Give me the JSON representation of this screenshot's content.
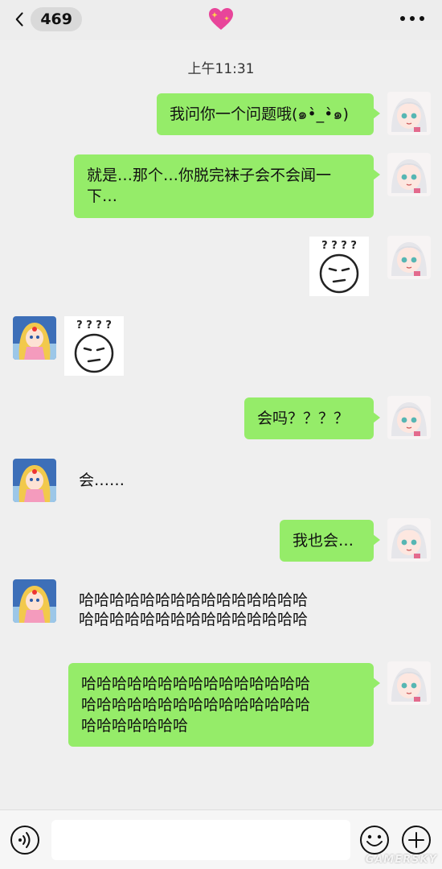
{
  "header": {
    "back_icon": "chevron-left-icon",
    "unread_count": "469",
    "title_icon": "sparkling-heart-icon",
    "more_icon": "more-dots-icon"
  },
  "chat": {
    "timestamp": "上午11:31",
    "messages": [
      {
        "side": "right",
        "kind": "text",
        "text": "我问你一个问题哦(๑•̀_•̀๑)"
      },
      {
        "side": "right",
        "kind": "text",
        "lines": [
          "就是…那个…你脱完袜子会不会闻一",
          "下…"
        ]
      },
      {
        "side": "right",
        "kind": "sticker",
        "caption": "? ? ? ?"
      },
      {
        "side": "left",
        "kind": "sticker",
        "caption": "? ? ? ?"
      },
      {
        "side": "right",
        "kind": "text",
        "text": "会吗？？？？"
      },
      {
        "side": "left",
        "kind": "text",
        "text": "会……"
      },
      {
        "side": "right",
        "kind": "text",
        "text": "我也会…"
      },
      {
        "side": "left",
        "kind": "text",
        "lines": [
          "哈哈哈哈哈哈哈哈哈哈哈哈哈哈哈",
          "哈哈哈哈哈哈哈哈哈哈哈哈哈哈哈"
        ]
      },
      {
        "side": "right",
        "kind": "text",
        "lines": [
          "哈哈哈哈哈哈哈哈哈哈哈哈哈哈哈",
          "哈哈哈哈哈哈哈哈哈哈哈哈哈哈哈",
          "哈哈哈哈哈哈哈"
        ]
      }
    ]
  },
  "footer": {
    "voice_icon": "voice-input-icon",
    "emoji_icon": "emoji-icon",
    "plus_icon": "plus-icon",
    "watermark": "GAMERSKY"
  },
  "colors": {
    "outgoing_bubble": "#95ec69",
    "background": "#efefef"
  }
}
